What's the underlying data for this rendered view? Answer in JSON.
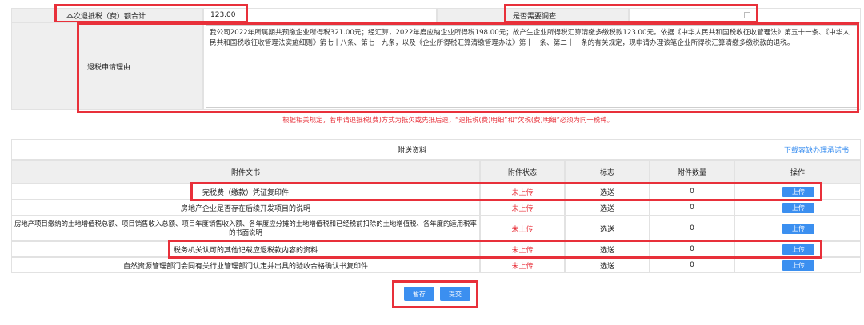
{
  "top": {
    "refund_total_label": "本次退抵税（费）额合计",
    "refund_total_value": "123.00",
    "investigate_label": "是否需要调查"
  },
  "reason": {
    "label": "退税申请理由",
    "text": "我公司2022年所属期共预缴企业所得税321.00元；经汇算，2022年度应纳企业所得税198.00元；故产生企业所得税汇算清缴多缴税款123.00元。依据《中华人民共和国税收征收管理法》第五十一条、《中华人民共和国税收征收管理法实施细则》第七十八条、第七十九条，以及《企业所得税汇算清缴管理办法》第十一条、第二十一条的有关规定，现申请办理该笔企业所得税汇算清缴多缴税款的退税。"
  },
  "notice": "根据相关规定，若申请退抵税(费)方式为抵欠或先抵后退，“退抵税(费)明细”和“欠税(费)明细”必须为同一税种。",
  "attachments": {
    "title": "附送资料",
    "download_link": "下载容缺办理承诺书",
    "headers": [
      "附件文书",
      "附件状态",
      "标志",
      "附件数量",
      "操作"
    ],
    "rows": [
      {
        "name": "完税费（缴款）凭证复印件",
        "status": "未上传",
        "flag": "选送",
        "count": "0",
        "action": "上传"
      },
      {
        "name": "房地产企业是否存在后续开发项目的说明",
        "status": "未上传",
        "flag": "选送",
        "count": "0",
        "action": "上传"
      },
      {
        "name": "房地产项目缴纳的土地增值税总额、项目销售收入总额、项目年度销售收入额、各年度应分摊的土地增值税和已经税前扣除的土地增值税、各年度的适用税率的书面说明",
        "status": "未上传",
        "flag": "选送",
        "count": "0",
        "action": "上传"
      },
      {
        "name": "税务机关认可的其他记载应退税款内容的资料",
        "status": "未上传",
        "flag": "选送",
        "count": "0",
        "action": "上传"
      },
      {
        "name": "自然资源管理部门会同有关行业管理部门认定并出具的验收合格确认书复印件",
        "status": "未上传",
        "flag": "选送",
        "count": "0",
        "action": "上传"
      }
    ]
  },
  "footer": {
    "save_label": "暂存",
    "submit_label": "提交"
  },
  "colors": {
    "highlight": "#e8303a",
    "button": "#3b8ff0",
    "status_red": "#e8303a"
  }
}
